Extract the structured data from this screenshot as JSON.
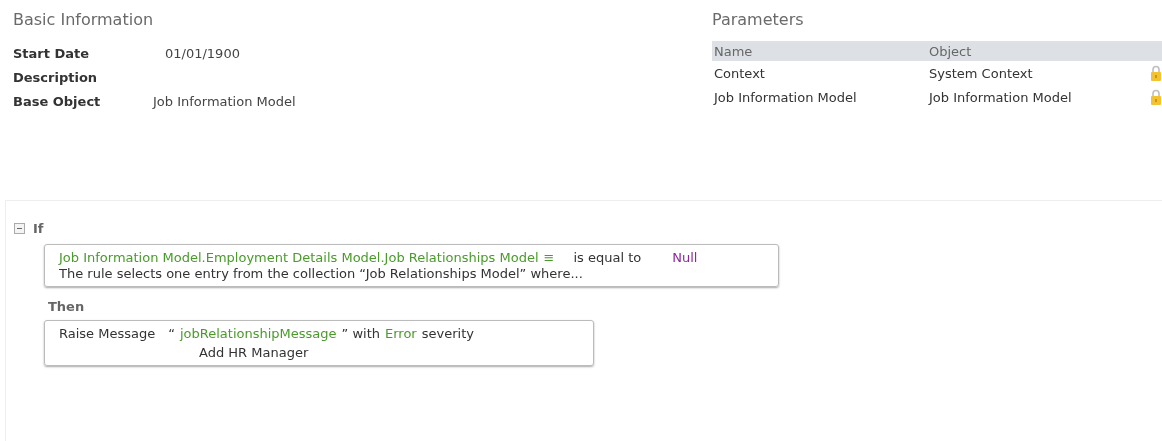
{
  "basic_information": {
    "title": "Basic Information",
    "fields": [
      {
        "label": "Start Date",
        "value": "01/01/1900"
      },
      {
        "label": "Description"
      },
      {
        "label": "Base Object",
        "value": "Job Information Model"
      }
    ]
  },
  "parameters": {
    "title": "Parameters",
    "columns": [
      "Name",
      "Object"
    ],
    "rows": [
      {
        "name": "Context",
        "object": "System Context",
        "locked": true
      },
      {
        "name": "Job Information Model",
        "object": "Job Information Model",
        "locked": true
      }
    ]
  },
  "rule": {
    "if_label": "If",
    "expanded": true,
    "condition": {
      "path": "Job Information Model.Employment Details Model.Job Relationships Model",
      "menu_glyph": "≡",
      "operator": "is equal to",
      "value": "Null",
      "description": "The rule selects one entry from the collection “Job Relationships Model” where..."
    },
    "then_label": "Then",
    "action": {
      "verb": "Raise Message",
      "quote_open": "“",
      "message": "jobRelationshipMessage",
      "with_text": "” with",
      "severity": "Error",
      "severity_text": "severity",
      "detail": "Add HR Manager"
    }
  }
}
